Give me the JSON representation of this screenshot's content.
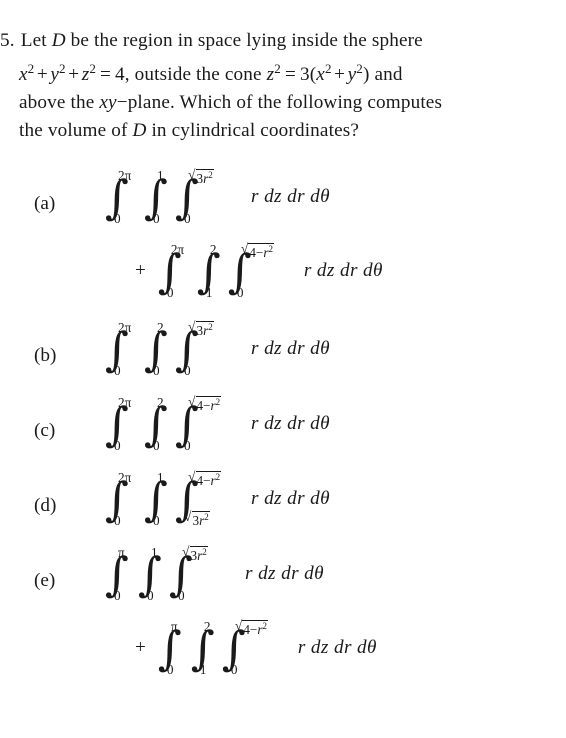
{
  "document": {
    "background_color": "#ffffff",
    "text_color": "#1a1a1a"
  },
  "question": {
    "number": "5.",
    "lines": [
      "Let D be the region in space lying inside the sphere",
      "x² + y² + z² = 4, outside the cone z² = 3(x² + y²) and",
      "above the xy−plane. Which of the following computes",
      "the volume of D in cylindrical coordinates?"
    ],
    "tokens": {
      "let": "Let",
      "region_var": "D",
      "be_the_region": "be the region in space lying inside the sphere",
      "x": "x",
      "y": "y",
      "z": "z",
      "two": "2",
      "plus": "+",
      "equals": "=",
      "four": "4",
      "comma_outside_the_cone": ", outside the cone",
      "three": "3",
      "lparen": "(",
      "rparen": ")",
      "and": "and",
      "above_the": "above the",
      "xy": "xy",
      "minus": "−",
      "plane_which": "plane. Which of the following computes",
      "the_volume_of": "the volume of",
      "in_cylindrical": "in cylindrical coordinates?"
    }
  },
  "integrand": {
    "text": "r dz dr dθ",
    "r": "r",
    "dz": "dz",
    "dr": "dr",
    "dtheta": "dθ"
  },
  "symbols": {
    "integral": "∫",
    "radical": "√",
    "plus": "+",
    "zero": "0",
    "one": "1",
    "two": "2",
    "two_pi": "2π",
    "pi": "π"
  },
  "options": [
    {
      "label": "(a)",
      "terms": [
        {
          "connector": "",
          "limits": [
            {
              "lower": "0",
              "upper": "2π"
            },
            {
              "lower": "0",
              "upper": "1"
            },
            {
              "lower": "0",
              "upper_sqrt": "3r²"
            }
          ],
          "integrand": "r dz dr dθ"
        },
        {
          "connector": "+",
          "limits": [
            {
              "lower": "0",
              "upper": "2π"
            },
            {
              "lower": "1",
              "upper": "2"
            },
            {
              "lower": "0",
              "upper_sqrt": "4−r²"
            }
          ],
          "integrand": "r dz dr dθ"
        }
      ]
    },
    {
      "label": "(b)",
      "terms": [
        {
          "connector": "",
          "limits": [
            {
              "lower": "0",
              "upper": "2π"
            },
            {
              "lower": "0",
              "upper": "2"
            },
            {
              "lower": "0",
              "upper_sqrt": "3r²"
            }
          ],
          "integrand": "r dz dr dθ"
        }
      ]
    },
    {
      "label": "(c)",
      "terms": [
        {
          "connector": "",
          "limits": [
            {
              "lower": "0",
              "upper": "2π"
            },
            {
              "lower": "0",
              "upper": "2"
            },
            {
              "lower": "0",
              "upper_sqrt": "4−r²"
            }
          ],
          "integrand": "r dz dr dθ"
        }
      ]
    },
    {
      "label": "(d)",
      "terms": [
        {
          "connector": "",
          "limits": [
            {
              "lower": "0",
              "upper": "2π"
            },
            {
              "lower": "0",
              "upper": "1"
            },
            {
              "lower_sqrt": "3r²",
              "upper_sqrt": "4−r²"
            }
          ],
          "integrand": "r dz dr dθ"
        }
      ]
    },
    {
      "label": "(e)",
      "terms": [
        {
          "connector": "",
          "limits": [
            {
              "lower": "0",
              "upper": "π"
            },
            {
              "lower": "0",
              "upper": "1"
            },
            {
              "lower": "0",
              "upper_sqrt": "3r²"
            }
          ],
          "integrand": "r dz dr dθ"
        },
        {
          "connector": "+",
          "limits": [
            {
              "lower": "0",
              "upper": "π"
            },
            {
              "lower": "1",
              "upper": "2"
            },
            {
              "lower": "0",
              "upper_sqrt": "4−r²"
            }
          ],
          "integrand": "r dz dr dθ"
        }
      ]
    }
  ]
}
